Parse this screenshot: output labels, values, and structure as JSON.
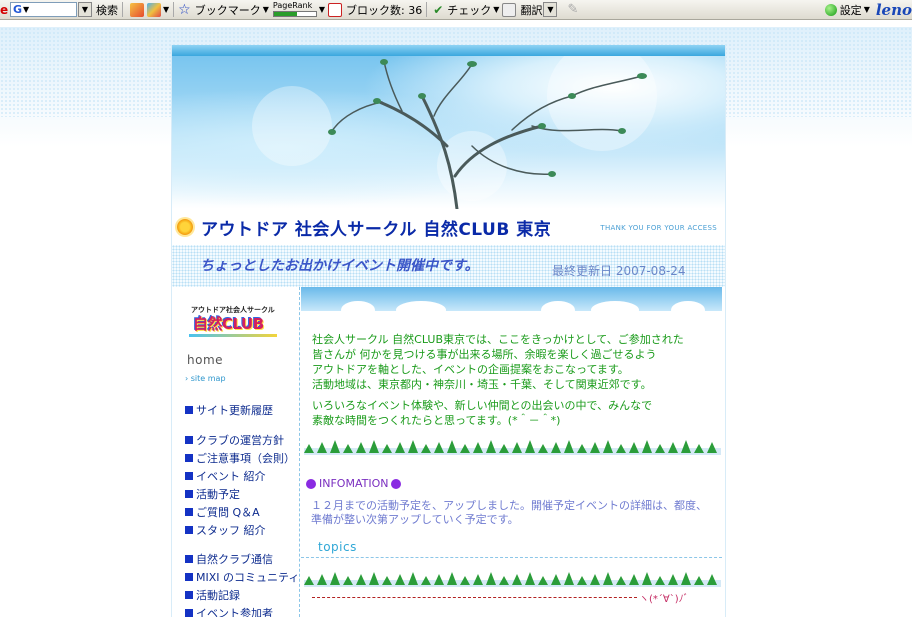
{
  "toolbar": {
    "left_glyph": "e",
    "search_engine": "G",
    "search_label": "検索",
    "bookmark_label": "ブックマーク",
    "pagerank_label": "PageRank",
    "popup_label": "ブロック数: 36",
    "check_label": "チェック",
    "translate_label": "翻訳",
    "settings_label": "設定",
    "brand": "leno"
  },
  "header": {
    "title": "アウトドア 社会人サークル 自然CLUB 東京",
    "thanks": "THANK YOU FOR YOUR ACCESS",
    "catchphrase": "ちょっとしたお出かけイベント開催中です。",
    "updated": "最終更新日 2007-08-24"
  },
  "logo": {
    "small": "アウトドア社会人サークル",
    "big": "自然CLUB"
  },
  "nav": {
    "home": "home",
    "sitemap": "site map",
    "items": [
      "サイト更新履歴",
      "クラブの運営方針",
      "ご注意事項（会則）",
      "イベント 紹介",
      "活動予定",
      "ご質問 Q＆A",
      "スタッフ 紹介",
      "自然クラブ通信",
      "MIXI のコミュニティ",
      "活動記録",
      "イベント参加者"
    ]
  },
  "content": {
    "intro_lines": [
      "社会人サークル 自然CLUB東京では、ここをきっかけとして、ご参加された",
      "皆さんが 何かを見つける事が出来る場所、余暇を楽しく過ごせるよう",
      "アウトドアを軸とした、イベントの企画提案をおこなってます。",
      "活動地域は、東京都内・神奈川・埼玉・千葉、そして関東近郊です。"
    ],
    "intro2_lines": [
      "いろいろなイベント体験や、新しい仲間との出会いの中で、みんなで",
      "素敵な時間をつくれたらと思ってます。(*＾－＾*)"
    ],
    "info_heading": "INFOMATION",
    "info_text": "１２月までの活動予定を、アップしました。開催予定イベントの詳細は、都度、準備が整い次第アップしていく予定です。",
    "topics_heading": "topics",
    "kaomoji": "ヽ(*´∀`)ﾉﾞ"
  },
  "colors": {
    "title": "#0a2aa8",
    "nav_link": "#0e2c8f",
    "intro_text": "#1a9b1a",
    "info_text": "#6f7bd0",
    "accent_sky": "#3aa7de"
  }
}
